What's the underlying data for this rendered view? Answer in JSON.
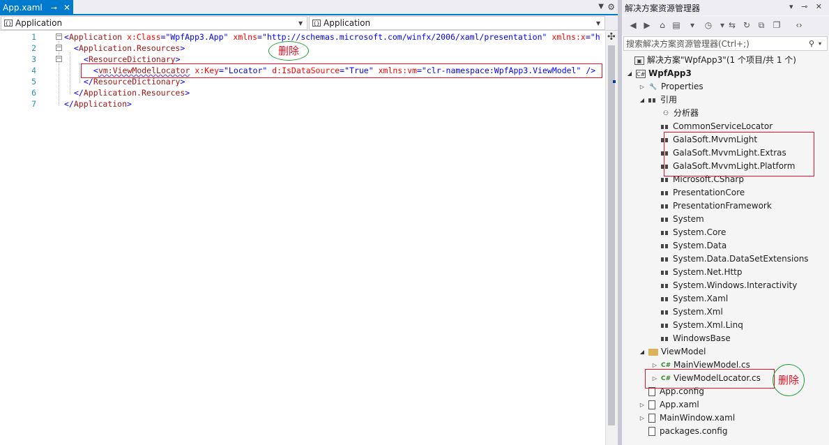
{
  "editor": {
    "tab": {
      "label": "App.xaml",
      "pin_icon": "pin-icon",
      "close_icon": "close-icon"
    },
    "nav": {
      "left": "Application",
      "right": "Application"
    },
    "lines": [
      {
        "n": "1",
        "parts": [
          {
            "c": "b",
            "t": "<"
          },
          {
            "c": "t",
            "t": "Application"
          },
          {
            "c": "a",
            "t": " x:Class"
          },
          {
            "c": "b",
            "t": "=\""
          },
          {
            "c": "v",
            "t": "WpfApp3.App"
          },
          {
            "c": "b",
            "t": "\""
          },
          {
            "c": "a",
            "t": " xmlns"
          },
          {
            "c": "b",
            "t": "=\""
          },
          {
            "c": "v",
            "t": "http://schemas.microsoft.com/winfx/2006/xaml/presentation"
          },
          {
            "c": "b",
            "t": "\""
          },
          {
            "c": "a",
            "t": " xmlns:x"
          },
          {
            "c": "b",
            "t": "=\"h"
          }
        ]
      },
      {
        "n": "2",
        "parts": [
          {
            "c": "b",
            "t": "<"
          },
          {
            "c": "t",
            "t": "Application.Resources"
          },
          {
            "c": "b",
            "t": ">"
          }
        ]
      },
      {
        "n": "3",
        "parts": [
          {
            "c": "b",
            "t": "<"
          },
          {
            "c": "t",
            "t": "ResourceDictionary"
          },
          {
            "c": "b",
            "t": ">"
          }
        ]
      },
      {
        "n": "4",
        "parts": [
          {
            "c": "b",
            "t": "<"
          },
          {
            "c": "t sq",
            "t": "vm:ViewModelLocator"
          },
          {
            "c": "a",
            "t": " x:Key"
          },
          {
            "c": "b",
            "t": "=\""
          },
          {
            "c": "v",
            "t": "Locator"
          },
          {
            "c": "b",
            "t": "\""
          },
          {
            "c": "a",
            "t": " d:IsDataSource"
          },
          {
            "c": "b",
            "t": "=\""
          },
          {
            "c": "v",
            "t": "True"
          },
          {
            "c": "b",
            "t": "\""
          },
          {
            "c": "a",
            "t": " xmlns:vm"
          },
          {
            "c": "b",
            "t": "=\""
          },
          {
            "c": "v",
            "t": "clr-namespace:WpfApp3.ViewModel"
          },
          {
            "c": "b",
            "t": "\" />"
          }
        ]
      },
      {
        "n": "5",
        "parts": [
          {
            "c": "b",
            "t": "</"
          },
          {
            "c": "t",
            "t": "ResourceDictionary"
          },
          {
            "c": "b",
            "t": ">"
          }
        ]
      },
      {
        "n": "6",
        "parts": [
          {
            "c": "b",
            "t": "</"
          },
          {
            "c": "t",
            "t": "Application.Resources"
          },
          {
            "c": "b",
            "t": ">"
          }
        ]
      },
      {
        "n": "7",
        "parts": [
          {
            "c": "b",
            "t": "</"
          },
          {
            "c": "t",
            "t": "Application"
          },
          {
            "c": "b",
            "t": ">"
          }
        ]
      }
    ],
    "annotation": "删除"
  },
  "solution_explorer": {
    "title": "解决方案资源管理器",
    "search_placeholder": "搜索解决方案资源管理器(Ctrl+;)",
    "solution": "解决方案\"WpfApp3\"(1 个项目/共 1 个)",
    "project": "WpfApp3",
    "properties": "Properties",
    "references_label": "引用",
    "analyzer": "分析器",
    "references": [
      "CommonServiceLocator",
      "GalaSoft.MvvmLight",
      "GalaSoft.MvvmLight.Extras",
      "GalaSoft.MvvmLight.Platform",
      "Microsoft.CSharp",
      "PresentationCore",
      "PresentationFramework",
      "System",
      "System.Core",
      "System.Data",
      "System.Data.DataSetExtensions",
      "System.Net.Http",
      "System.Windows.Interactivity",
      "System.Xaml",
      "System.Xml",
      "System.Xml.Linq",
      "WindowsBase"
    ],
    "viewmodel_folder": "ViewModel",
    "viewmodel_files": [
      "MainViewModel.cs",
      "ViewModelLocator.cs"
    ],
    "files": [
      "App.config",
      "App.xaml",
      "MainWindow.xaml",
      "packages.config"
    ],
    "annotation": "删除"
  }
}
